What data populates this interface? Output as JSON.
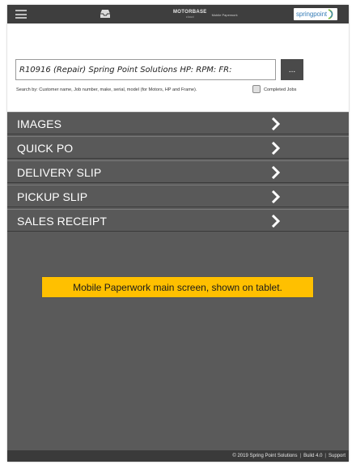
{
  "topbar": {
    "menu_icon": "hamburger-icon",
    "inbox_icon": "inbox-tray-icon",
    "brand_name": "MOTORBASE",
    "brand_sub": "cloud",
    "brand_tag": "Mobile Paperwork",
    "partner_logo": "springpoint"
  },
  "job": {
    "value": "R10916 (Repair) Spring Point Solutions  HP: RPM: FR:",
    "more_label": "...",
    "search_hint": "Search by: Customer name, Job number, make, serial, model (for Motors, HP and Frame).",
    "completed_label": "Completed Jobs",
    "completed_checked": false
  },
  "menu": {
    "items": [
      {
        "label": "IMAGES"
      },
      {
        "label": "QUICK PO"
      },
      {
        "label": "DELIVERY SLIP"
      },
      {
        "label": "PICKUP SLIP"
      },
      {
        "label": "SALES RECEIPT"
      }
    ],
    "chevron_icon": "chevron-right-icon"
  },
  "callout": {
    "text": "Mobile Paperwork main screen, shown on tablet."
  },
  "footer": {
    "copyright": "© 2019 Spring Point Solutions",
    "sep1": "|",
    "build": "Build 4.0",
    "sep2": "|",
    "support": "Support"
  },
  "colors": {
    "frame": "#5a5a5a",
    "topbar": "#3e3e3e",
    "menu_item": "#595959",
    "callout": "#ffc000",
    "brand_blue": "#3a7fb8"
  }
}
